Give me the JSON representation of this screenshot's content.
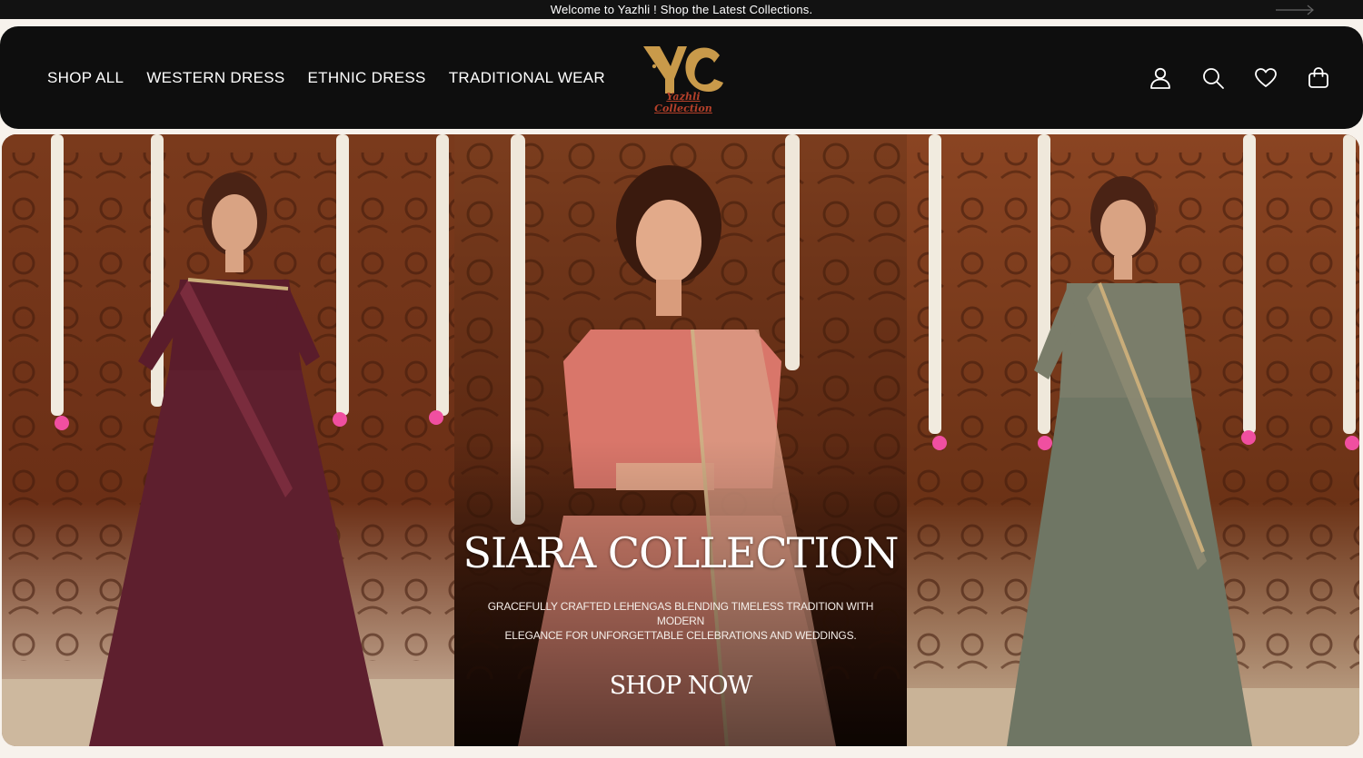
{
  "announcement": {
    "text": "Welcome to Yazhli ! Shop the Latest Collections.",
    "icon": "arrow-right-icon"
  },
  "header": {
    "nav": [
      {
        "label": "SHOP ALL"
      },
      {
        "label": "WESTERN DRESS"
      },
      {
        "label": "ETHNIC DRESS"
      },
      {
        "label": "TRADITIONAL WEAR"
      }
    ],
    "logo": {
      "text": "Yazhli Collection",
      "monogram": "YC",
      "gold": "#c99a4a",
      "red": "#b5402a"
    },
    "icons": [
      "account-icon",
      "search-icon",
      "wishlist-heart-icon",
      "cart-bag-icon"
    ]
  },
  "hero": {
    "title": "SIARA COLLECTION",
    "subtitle_line1": "GRACEFULLY CRAFTED LEHENGAS BLENDING TIMELESS TRADITION WITH MODERN",
    "subtitle_line2": "ELEGANCE FOR UNFORGETTABLE CELEBRATIONS AND WEDDINGS.",
    "cta": "SHOP NOW",
    "colors": {
      "backdrop": "#6b3419",
      "garland": "#f3ece0",
      "left_outfit": "#5e1f2e",
      "mid_outfit": "#d9766a",
      "right_outfit": "#6f7664"
    }
  },
  "colors": {
    "header_bg": "#0e0e0e",
    "announce_bg": "#121212",
    "page_bg": "#f7f2ec"
  }
}
